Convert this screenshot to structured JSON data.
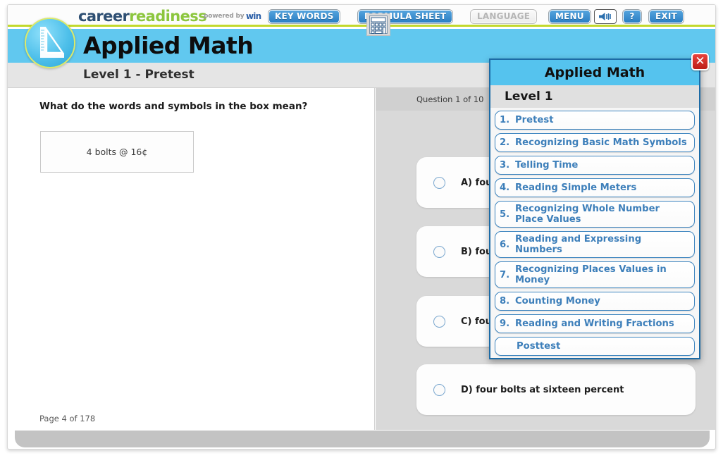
{
  "brand": {
    "career": "career",
    "readiness": "readiness",
    "powered_by": "powered by",
    "win": "win"
  },
  "toolbar": {
    "key_words": "KEY WORDS",
    "formula_sheet": "FORMULA SHEET",
    "language": "LANGUAGE",
    "menu": "MENU",
    "sound_icon": "speaker-icon",
    "help": "?",
    "exit": "EXIT"
  },
  "header": {
    "title": "Applied Math",
    "level_label": "Level 1 - Pretest",
    "badge_icon": "ruler-triangle-icon"
  },
  "left": {
    "question_text": "What do the words and symbols in the box mean?",
    "calculator_icon": "calculator-icon",
    "stimulus": "4 bolts @ 16¢",
    "page_counter": "Page 4 of 178"
  },
  "right": {
    "progress": "Question 1 of 10",
    "choices": [
      {
        "letter": "A)",
        "text": "four bolts at sixteen cents",
        "selected": false
      },
      {
        "letter": "B)",
        "text": "four bolts at sixteen dollars",
        "selected": false
      },
      {
        "letter": "C)",
        "text": "four bolts at sixteen",
        "selected": false
      },
      {
        "letter": "D)",
        "text": "four bolts at sixteen percent",
        "selected": false
      }
    ]
  },
  "menu_popup": {
    "title": "Applied Math",
    "subtitle": "Level 1",
    "close_glyph": "✕",
    "items": [
      {
        "num": "1.",
        "label": "Pretest"
      },
      {
        "num": "2.",
        "label": "Recognizing Basic Math Symbols"
      },
      {
        "num": "3.",
        "label": "Telling Time"
      },
      {
        "num": "4.",
        "label": "Reading Simple Meters"
      },
      {
        "num": "5.",
        "label": "Recognizing Whole Number Place Values"
      },
      {
        "num": "6.",
        "label": "Reading and Expressing Numbers"
      },
      {
        "num": "7.",
        "label": "Recognizing Places Values in Money"
      },
      {
        "num": "8.",
        "label": "Counting Money"
      },
      {
        "num": "9.",
        "label": "Reading and Writing Fractions"
      },
      {
        "num": "",
        "label": "Posttest"
      }
    ]
  },
  "colors": {
    "brand_blue": "#2e4f73",
    "brand_green": "#8cc63e",
    "title_band": "#61c8ef",
    "button_blue": "#2b7fc4",
    "menu_link": "#3d7fba",
    "close_red": "#bd1d18",
    "accent_lime": "#c2d92c"
  }
}
